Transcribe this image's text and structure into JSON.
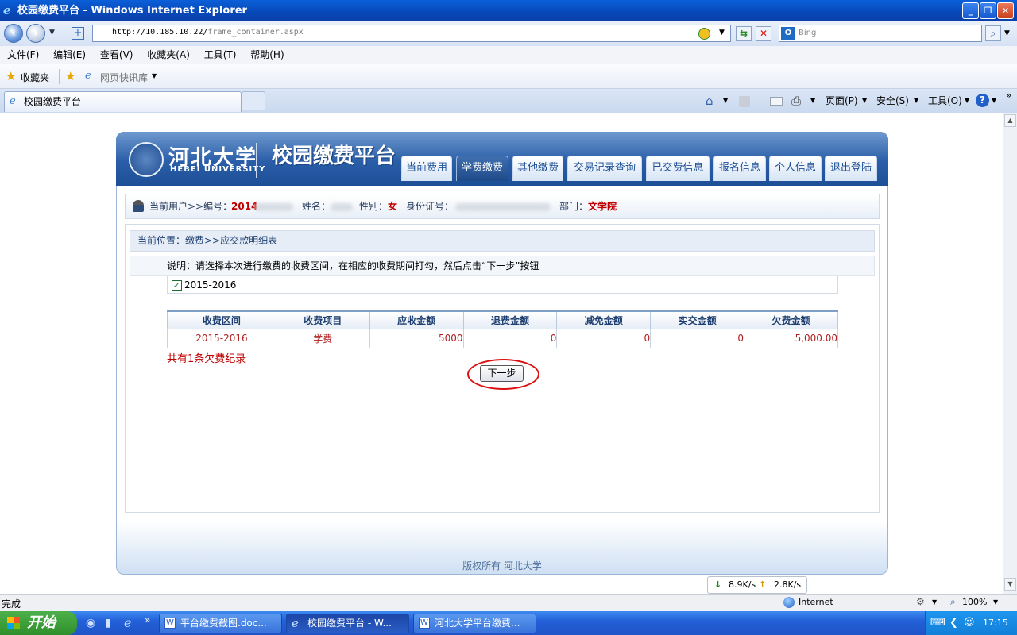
{
  "window": {
    "title": "校园缴费平台 - Windows Internet Explorer"
  },
  "browser": {
    "url_host": "http://10.185.10.22/",
    "url_path": "frame_container.aspx",
    "search_placeholder": "Bing",
    "menu": [
      "文件(F)",
      "编辑(E)",
      "查看(V)",
      "收藏夹(A)",
      "工具(T)",
      "帮助(H)"
    ],
    "favorites_label": "收藏夹",
    "quicklib_label": "网页快讯库",
    "tab_title": "校园缴费平台",
    "toolbar": {
      "page": "页面(P)",
      "safety": "安全(S)",
      "tools": "工具(O)"
    },
    "status_text": "完成",
    "zone": "Internet",
    "zoom": "100%",
    "speed_down": "8.9K/s",
    "speed_up": "2.8K/s"
  },
  "site": {
    "logo_cn": "河北大学",
    "logo_en": "HEBEI UNIVERSITY",
    "system_title": "校园缴费平台",
    "nav": [
      "当前费用",
      "学费缴费",
      "其他缴费",
      "交易记录查询",
      "已交费信息",
      "报名信息",
      "个人信息",
      "退出登陆"
    ],
    "active_nav": "学费缴费",
    "user": {
      "prefix": "当前用户>>编号：",
      "id": "2014",
      "name_label": "姓名：",
      "gender_label": "性别：",
      "gender": "女",
      "idcard_label": "身份证号：",
      "dept_label": "部门：",
      "dept": "文学院"
    },
    "location": "当前位置：缴费>>应交款明细表",
    "instruction": "说明：请选择本次进行缴费的收费区间，在相应的收费期间打勾，然后点击“下一步”按钮",
    "period_option": "2015-2016",
    "table": {
      "headers": [
        "收费区间",
        "收费项目",
        "应收金额",
        "退费金额",
        "减免金额",
        "实交金额",
        "欠费金额"
      ],
      "rows": [
        [
          "2015-2016",
          "学费",
          "5000",
          "0",
          "0",
          "0",
          "5,000.00"
        ]
      ]
    },
    "summary": "共有1条欠费纪录",
    "next_button": "下一步",
    "footer": "版权所有 河北大学"
  },
  "taskbar": {
    "start": "开始",
    "tasks": [
      "平台缴费截图.doc...",
      "校园缴费平台 - W...",
      "河北大学平台缴费..."
    ],
    "clock": "17:15"
  }
}
